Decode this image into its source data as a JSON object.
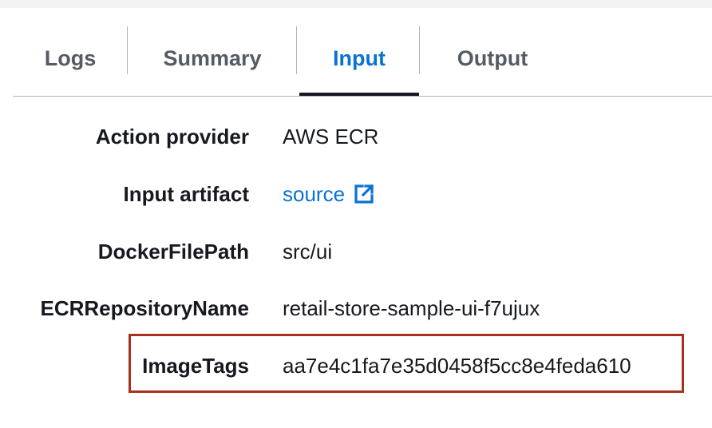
{
  "tabs": [
    {
      "label": "Logs",
      "active": false
    },
    {
      "label": "Summary",
      "active": false
    },
    {
      "label": "Input",
      "active": true
    },
    {
      "label": "Output",
      "active": false
    }
  ],
  "details": {
    "action_provider": {
      "key": "Action provider",
      "value": "AWS ECR"
    },
    "input_artifact": {
      "key": "Input artifact",
      "value": "source",
      "icon": "external-link-icon"
    },
    "docker_file_path": {
      "key": "DockerFilePath",
      "value": "src/ui"
    },
    "ecr_repository_name": {
      "key": "ECRRepositoryName",
      "value": "retail-store-sample-ui-f7ujux"
    },
    "image_tags": {
      "key": "ImageTags",
      "value": "aa7e4c1fa7e35d0458f5cc8e4feda610"
    }
  },
  "colors": {
    "active_tab": "#0972d3",
    "inactive_tab": "#545b64",
    "link": "#0972d3",
    "highlight_border": "#a9301e"
  }
}
